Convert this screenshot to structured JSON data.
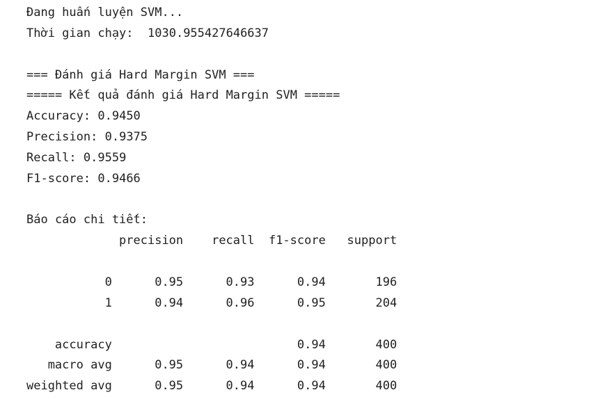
{
  "output": {
    "training_msg": "Đang huấn luyện SVM...",
    "runtime": {
      "label": "Thời gian chạy:",
      "value": "1030.955427646637"
    },
    "eval_heading": "=== Đánh giá Hard Margin SVM ===",
    "results_heading": "===== Kết quả đánh giá Hard Margin SVM =====",
    "metrics": {
      "accuracy": {
        "label": "Accuracy:",
        "value": "0.9450"
      },
      "precision": {
        "label": "Precision:",
        "value": "0.9375"
      },
      "recall": {
        "label": "Recall:",
        "value": "0.9559"
      },
      "f1": {
        "label": "F1-score:",
        "value": "0.9466"
      }
    },
    "report_title": "Báo cáo chi tiết:",
    "report": {
      "headers": [
        "precision",
        "recall",
        "f1-score",
        "support"
      ],
      "rows": [
        {
          "label": "0",
          "precision": "0.95",
          "recall": "0.93",
          "f1": "0.94",
          "support": "196"
        },
        {
          "label": "1",
          "precision": "0.94",
          "recall": "0.96",
          "f1": "0.95",
          "support": "204"
        }
      ],
      "summary": [
        {
          "label": "accuracy",
          "precision": "",
          "recall": "",
          "f1": "0.94",
          "support": "400"
        },
        {
          "label": "macro avg",
          "precision": "0.95",
          "recall": "0.94",
          "f1": "0.94",
          "support": "400"
        },
        {
          "label": "weighted avg",
          "precision": "0.95",
          "recall": "0.94",
          "f1": "0.94",
          "support": "400"
        }
      ]
    }
  }
}
